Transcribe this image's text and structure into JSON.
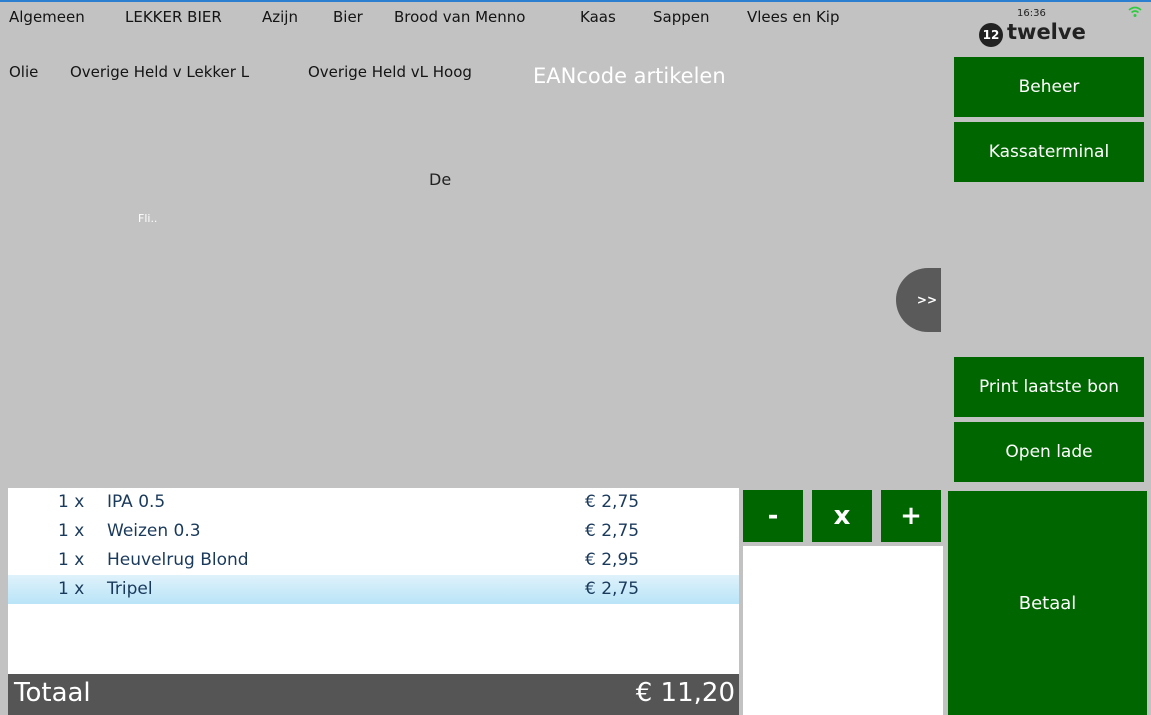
{
  "categories_row1": [
    "Algemeen",
    "LEKKER BIER",
    "Azijn",
    "Bier",
    "Brood van Menno",
    "Kaas",
    "Sappen",
    "Vlees en Kip"
  ],
  "categories_row2": [
    "Olie",
    "Overige Held v Lekker L",
    "Overige Held vL Hoog"
  ],
  "ean_label": "EANcode artikelen",
  "header": {
    "time": "16:36",
    "logo_mark": "12",
    "logo_text": "twelve"
  },
  "side_buttons": {
    "beheer": "Beheer",
    "kassaterminal": "Kassaterminal",
    "print": "Print laatste bon",
    "open_lade": "Open lade",
    "betaal": "Betaal"
  },
  "expand_tab": ">>",
  "ghost_text": {
    "main": "De",
    "faint": "Fli.."
  },
  "order_lines": [
    {
      "qty": "1 x",
      "name": "IPA 0.5",
      "price": "€ 2,75"
    },
    {
      "qty": "1 x",
      "name": "Weizen 0.3",
      "price": "€ 2,75"
    },
    {
      "qty": "1 x",
      "name": "Heuvelrug Blond",
      "price": "€ 2,95"
    },
    {
      "qty": "1 x",
      "name": "Tripel",
      "price": "€ 2,75"
    }
  ],
  "total": {
    "label": "Totaal",
    "amount": "€ 11,20"
  },
  "qty_buttons": {
    "minus": "-",
    "remove": "x",
    "plus": "+"
  },
  "colors": {
    "background": "#c2c2c2",
    "green": "#006600",
    "total_bar": "#555555",
    "selected_row": "#b9e4f7"
  }
}
